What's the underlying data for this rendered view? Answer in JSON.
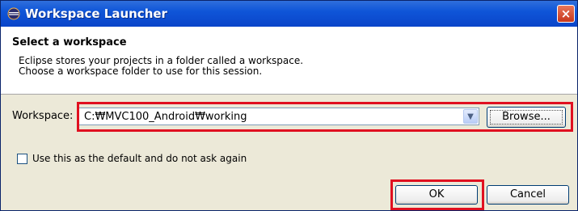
{
  "window": {
    "title": "Workspace Launcher",
    "close_glyph": "×"
  },
  "banner": {
    "title": "Select a workspace",
    "description_line1": "Eclipse stores your projects in a folder called a workspace.",
    "description_line2": "Choose a workspace folder to use for this session."
  },
  "workspace": {
    "label": "Workspace:",
    "value": "C:₩MVC100_Android₩working",
    "dropdown_icon": "chevron-down-icon",
    "browse_label": "Browse..."
  },
  "options": {
    "default_checkbox_label": "Use this as the default and do not ask again",
    "default_checked": false
  },
  "buttons": {
    "ok_label": "OK",
    "cancel_label": "Cancel"
  },
  "colors": {
    "titlebar": "#0a45c9",
    "highlight": "#e01020",
    "dialog_bg": "#ece9d8"
  }
}
